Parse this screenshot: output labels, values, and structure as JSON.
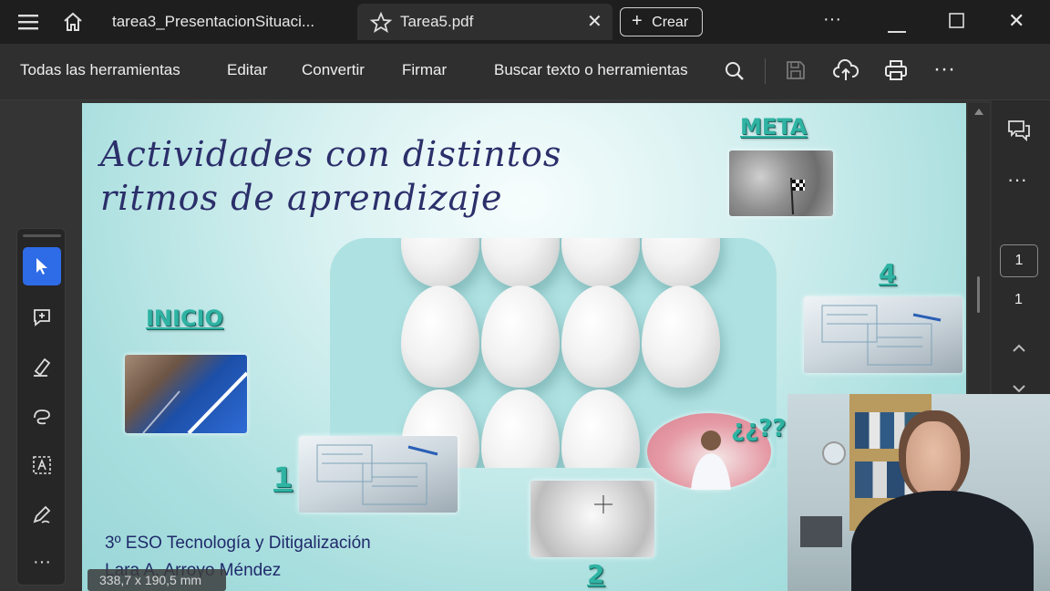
{
  "titlebar": {
    "tabs": [
      {
        "label": "tarea3_PresentacionSituaci..."
      },
      {
        "label": "Tarea5.pdf"
      }
    ],
    "create_label": "Crear"
  },
  "toolbar": {
    "menu": [
      "Todas las herramientas",
      "Editar",
      "Convertir",
      "Firmar"
    ],
    "search_label": "Buscar texto o herramientas"
  },
  "slide": {
    "title_line1": "Actividades con distintos",
    "title_line2": "ritmos de aprendizaje",
    "meta": "META",
    "inicio": "INICIO",
    "step1": "1",
    "step2": "2",
    "step4": "4",
    "question": "¿¿??",
    "footer1": "3º ESO Tecnología y Ditigalización",
    "footer2": "Lara A. Arroyo Méndez"
  },
  "status": {
    "dimensions": "338,7 x 190,5 mm"
  },
  "navigation": {
    "current_page": "1",
    "total_pages": "1"
  },
  "colors": {
    "accent_teal": "#2fb3a3",
    "title_navy": "#2b2f6a",
    "select_blue": "#2e6be6"
  }
}
